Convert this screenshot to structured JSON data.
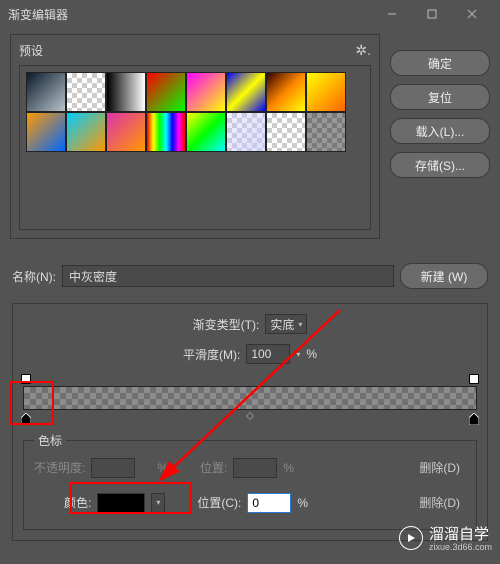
{
  "window": {
    "title": "渐变编辑器"
  },
  "presets": {
    "label": "预设"
  },
  "buttons": {
    "ok": "确定",
    "reset": "复位",
    "load": "载入(L)...",
    "save": "存储(S)...",
    "new": "新建 (W)",
    "delete": "删除(D)"
  },
  "name": {
    "label": "名称(N):",
    "value": "中灰密度"
  },
  "grad": {
    "type_label": "渐变类型(T):",
    "type_value": "实底",
    "smooth_label": "平滑度(M):",
    "smooth_value": "100",
    "pct": "%"
  },
  "stops": {
    "group": "色标",
    "opacity_label": "不透明度:",
    "opacity_pct": "%",
    "pos1_label": "位置:",
    "pos1_pct": "%",
    "color_label": "颜色:",
    "pos2_label": "位置(C):",
    "pos2_value": "0",
    "pos2_pct": "%"
  },
  "watermark": {
    "brand": "溜溜自学",
    "domain": "zixue.3d66.com"
  }
}
